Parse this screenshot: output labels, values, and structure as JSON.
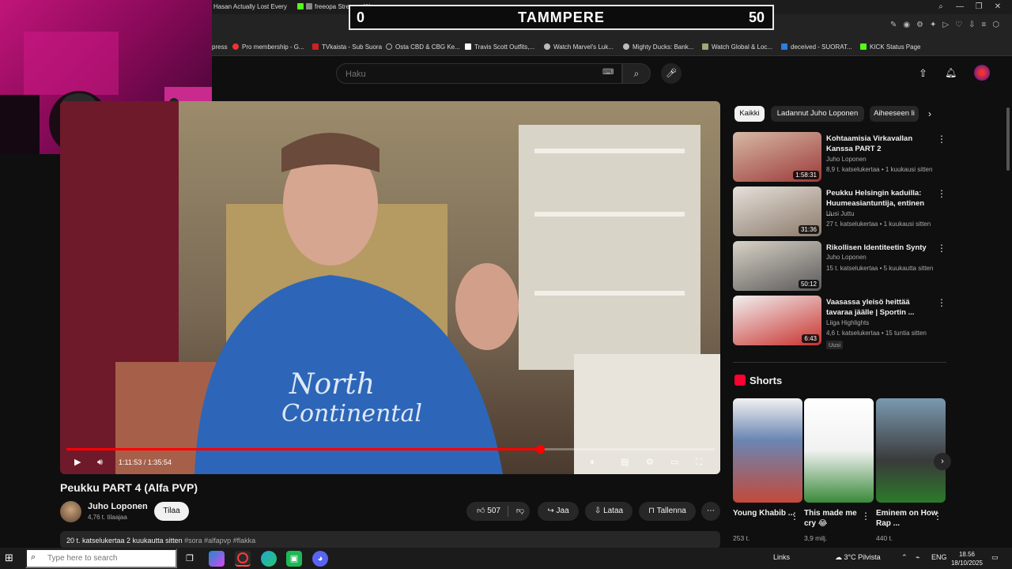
{
  "browser": {
    "tabs": [
      {
        "label": "Hasan Actually Lost Every"
      },
      {
        "label": "freeopa Stream - Wo"
      }
    ],
    "window_controls": {
      "search": "⌕",
      "minimize": "—",
      "restore": "❐",
      "close": "✕"
    },
    "bookmarks": [
      {
        "label": "press"
      },
      {
        "label": "Pro membership - G..."
      },
      {
        "label": "TVkaista - Sub Suora"
      },
      {
        "label": "Osta CBD & CBG Ke..."
      },
      {
        "label": "Travis Scott Outfits,..."
      },
      {
        "label": "Watch Marvel's Luk..."
      },
      {
        "label": "Mighty Ducks: Bank..."
      },
      {
        "label": "Watch Global & Loc..."
      },
      {
        "label": "deceived - SUORAT..."
      },
      {
        "label": "KICK Status Page"
      }
    ]
  },
  "overlay": {
    "score_left": "0",
    "score_title": "TAMMPERE",
    "score_right": "50"
  },
  "youtube": {
    "search_placeholder": "Haku",
    "player": {
      "time": "1:11:53 / 1:35:54",
      "progress": 0.73
    },
    "video": {
      "title": "Peukku PART 4 (Alfa PVP)",
      "channel": "Juho Loponen",
      "subscribers": "4,76 t. tilaajaa",
      "subscribe_label": "Tilaa",
      "likes": "507",
      "share_label": "Jaa",
      "download_label": "Lataa",
      "save_label": "Tallenna",
      "views_date": "20 t. katselukertaa  2 kuukautta sitten",
      "tags": "#sora #alfapvp #flakka"
    },
    "chips": [
      {
        "label": "Kaikki"
      },
      {
        "label": "Ladannut Juho Loponen"
      },
      {
        "label": "Aiheeseen li"
      }
    ],
    "recommendations": [
      {
        "title": "Kohtaamisia Virkavallan Kanssa PART 2",
        "channel": "Juho Loponen",
        "meta": "8,9 t. katselukertaa • 1 kuukausi sitten",
        "duration": "1:58:31"
      },
      {
        "title": "Peukku Helsingin kaduilla: Huumeasiantuntija, entinen ...",
        "channel": "Uusi Juttu",
        "meta": "27 t. katselukertaa • 1 kuukausi sitten",
        "duration": "31:36"
      },
      {
        "title": "Rikollisen Identiteetin Synty",
        "channel": "Juho Loponen",
        "meta": "15 t. katselukertaa • 5 kuukautta sitten",
        "duration": "50:12"
      },
      {
        "title": "Vaasassa yleisö heittää tavaraa jäälle | Sportin ...",
        "channel": "Liiga Highlights",
        "meta": "4,6 t. katselukertaa • 15 tuntia sitten",
        "duration": "6:43",
        "badge": "Uusi"
      }
    ],
    "shorts_title": "Shorts",
    "shorts": [
      {
        "title": "Young Khabib ...",
        "views": "253 t."
      },
      {
        "title": "This made me cry 😂",
        "views": "3,9 milj."
      },
      {
        "title": "Eminem on How Rap ...",
        "views": "440 t."
      }
    ]
  },
  "taskbar": {
    "search_placeholder": "Type here to search",
    "links_label": "Links",
    "weather": "3°C  Pilvista",
    "language": "ENG",
    "time": "18.56",
    "date": "18/10/2025"
  }
}
